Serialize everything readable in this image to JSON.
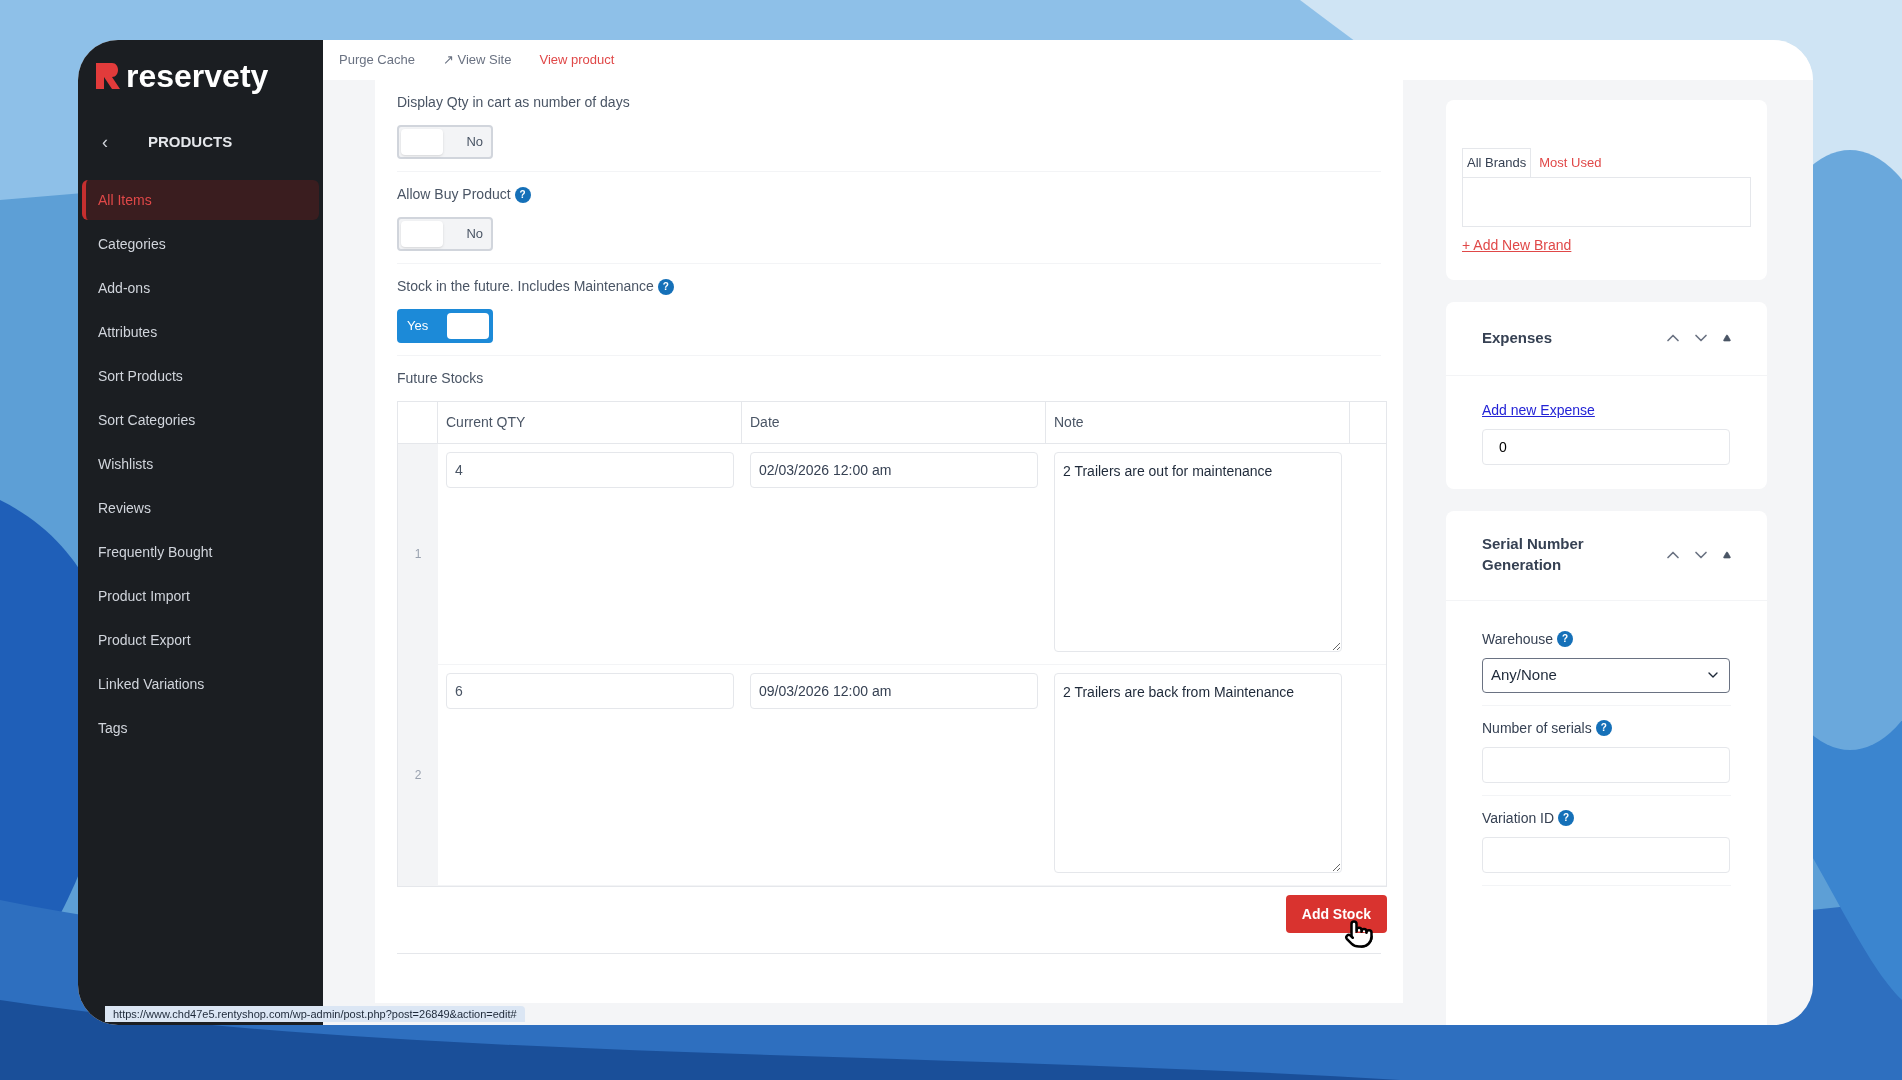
{
  "logo": {
    "text": "reservety"
  },
  "topbar": {
    "links": [
      {
        "label": "Purge Cache",
        "kind": "plain"
      },
      {
        "label": "↗ View Site",
        "kind": "plain"
      },
      {
        "label": "View product",
        "kind": "accent"
      }
    ]
  },
  "sidebar": {
    "back": "‹",
    "title": "PRODUCTS",
    "items": [
      {
        "label": "All Items",
        "selected": true
      },
      {
        "label": "Categories",
        "selected": false
      },
      {
        "label": "Add-ons",
        "selected": false
      },
      {
        "label": "Attributes",
        "selected": false
      },
      {
        "label": "Sort Products",
        "selected": false
      },
      {
        "label": "Sort Categories",
        "selected": false
      },
      {
        "label": "Wishlists",
        "selected": false
      },
      {
        "label": "Reviews",
        "selected": false
      },
      {
        "label": "Frequently Bought",
        "selected": false
      },
      {
        "label": "Product Import",
        "selected": false
      },
      {
        "label": "Product Export",
        "selected": false
      },
      {
        "label": "Linked Variations",
        "selected": false
      },
      {
        "label": "Tags",
        "selected": false
      }
    ]
  },
  "settings": [
    {
      "label": "Display Qty in cart as number of days",
      "toggle": {
        "on": false,
        "text": "No"
      }
    },
    {
      "label": "Allow Buy Product",
      "help": "?",
      "toggle": {
        "on": false,
        "text": "No"
      }
    },
    {
      "label": "Stock in the future. Includes Maintenance",
      "help": "?",
      "toggle": {
        "on": true,
        "text": "Yes"
      }
    }
  ],
  "future_stocks": {
    "title": "Future Stocks",
    "columns": [
      "Current QTY",
      "Date",
      "Note"
    ],
    "rows": [
      {
        "number": "1",
        "qty": "4",
        "date": "02/03/2026 12:00 am",
        "note": "2 Trailers are out for maintenance"
      },
      {
        "number": "2",
        "qty": "6",
        "date": "09/03/2026 12:00 am",
        "note": "2 Trailers are back from Maintenance"
      }
    ],
    "add_button": "Add Stock"
  },
  "status_url": "https://www.chd47e5.rentyshop.com/wp-admin/post.php?post=26849&action=edit#",
  "brands": {
    "tabs": [
      {
        "label": "All Brands",
        "selected": true
      },
      {
        "label": "Most Used",
        "selected": false
      }
    ],
    "add_link": "+ Add New Brand"
  },
  "expenses": {
    "title": "Expenses",
    "link": "Add new Expense",
    "value": "0"
  },
  "serial": {
    "title": "Serial Number Generation",
    "fields": [
      {
        "kind": "select",
        "label": "Warehouse",
        "help": "?",
        "value": "Any/None"
      },
      {
        "kind": "input",
        "label": "Number of serials",
        "help": "?"
      },
      {
        "kind": "input",
        "label": "Variation ID",
        "help": "?"
      }
    ]
  }
}
